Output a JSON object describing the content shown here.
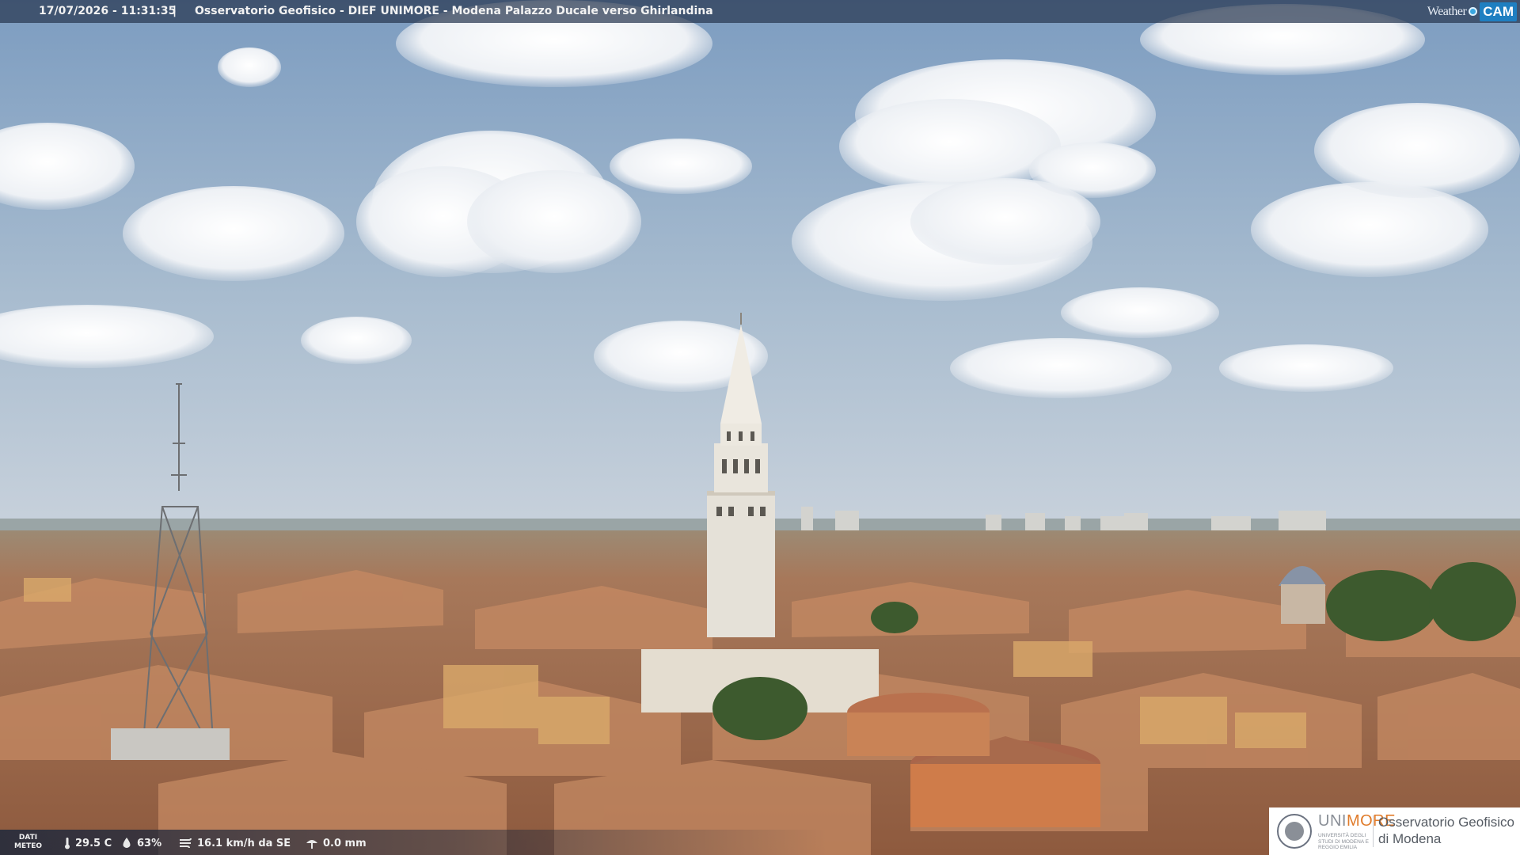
{
  "overlay": {
    "timestamp": "17/07/2026 - 11:31:35",
    "separator": "|",
    "title": "Osservatorio Geofisico - DIEF UNIMORE - Modena Palazzo Ducale verso Ghirlandina"
  },
  "logo": {
    "weather": "Weather",
    "cam": "CAM"
  },
  "weather_data": {
    "label_line1": "DATI",
    "label_line2": "METEO",
    "temperature": "29.5 C",
    "humidity": "63%",
    "wind": "16.1 km/h da SE",
    "rain": "0.0 mm",
    "icons": [
      "thermometer-icon",
      "humidity-icon",
      "wind-icon",
      "rain-gauge-icon"
    ]
  },
  "unimore": {
    "name_gray": "UNI",
    "name_orange": "MORE",
    "university_line": "UNIVERSITÀ DEGLI STUDI DI MODENA E REGGIO EMILIA",
    "observatory_line1": "Osservatorio Geofisico",
    "observatory_line2": "di Modena"
  },
  "colors": {
    "sky_top": "#7f9fc2",
    "sky_horizon": "#c3cfdc",
    "roof": "#b46f4c",
    "tower": "#e8e4dc",
    "unimore_orange": "#e07b2a"
  }
}
